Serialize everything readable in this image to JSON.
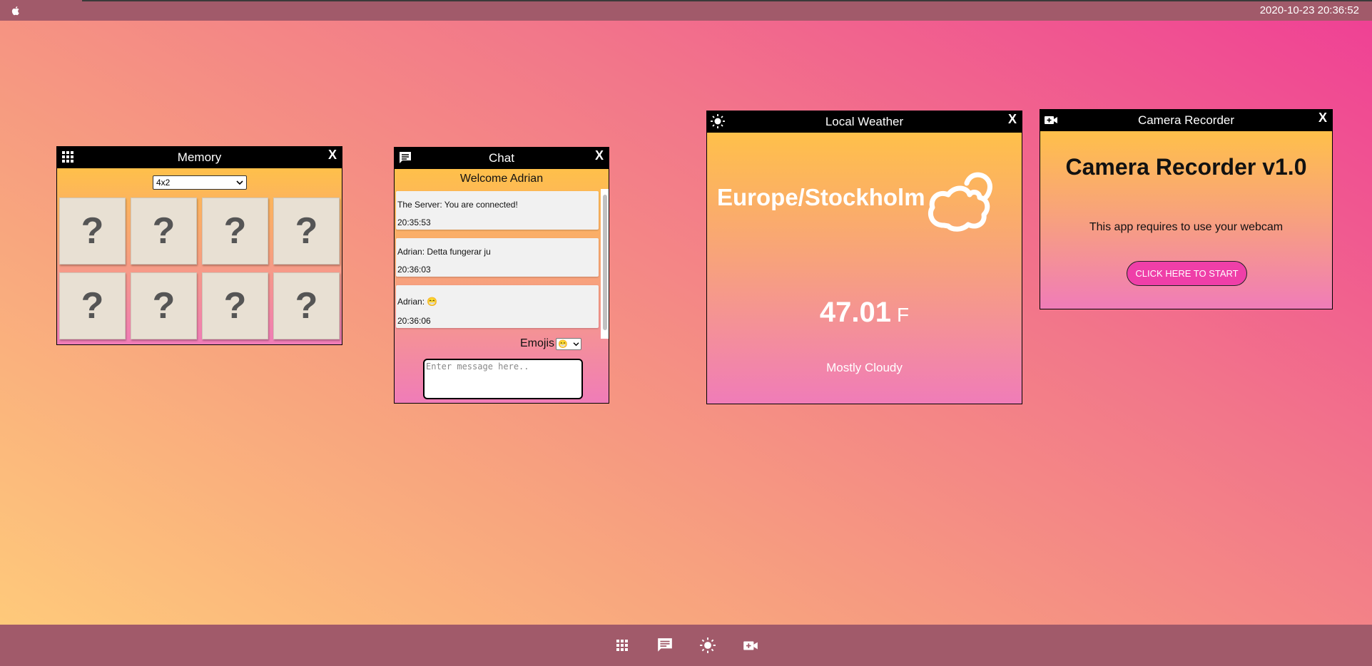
{
  "topbar": {
    "clock": "2020-10-23 20:36:52",
    "apple_icon": "apple-icon"
  },
  "memory": {
    "title": "Memory",
    "close": "X",
    "icon": "grid-icon",
    "size_select": "4x2",
    "cards": [
      "?",
      "?",
      "?",
      "?",
      "?",
      "?",
      "?",
      "?"
    ]
  },
  "chat": {
    "title": "Chat",
    "close": "X",
    "icon": "chat-bubble-icon",
    "welcome": "Welcome Adrian",
    "messages": [
      {
        "text": "The Server: You are connected!",
        "time": "20:35:53"
      },
      {
        "text": "Adrian: Detta fungerar ju",
        "time": "20:36:03"
      },
      {
        "text": "Adrian: 😁",
        "time": "20:36:06"
      }
    ],
    "emojis_label": "Emojis",
    "emoji_selected": "😁",
    "input_placeholder": "Enter message here.."
  },
  "weather": {
    "title": "Local Weather",
    "close": "X",
    "icon": "sun-icon",
    "city": "Europe/Stockholm",
    "temperature": "47.01",
    "unit": "F",
    "condition": "Mostly Cloudy",
    "condition_icon": "cloud-icon"
  },
  "camera": {
    "title": "Camera Recorder",
    "close": "X",
    "icon": "video-camera-icon",
    "heading": "Camera Recorder v1.0",
    "description": "This app requires to use your webcam",
    "start_button": "CLICK HERE TO START"
  },
  "taskbar": {
    "items": [
      "grid-icon",
      "chat-bubble-icon",
      "sun-icon",
      "video-camera-icon"
    ]
  }
}
